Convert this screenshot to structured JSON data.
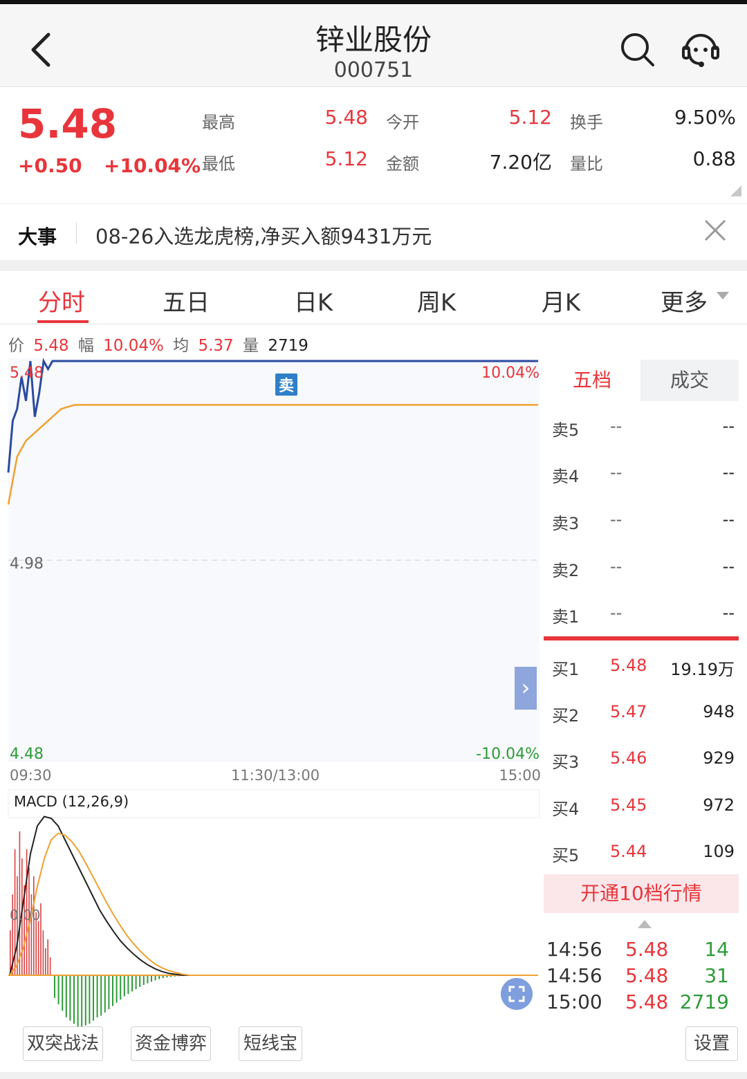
{
  "header": {
    "title": "锌业股份",
    "code": "000751"
  },
  "quote": {
    "price": "5.48",
    "change": "+0.50",
    "change_pct": "+10.04%",
    "stats": {
      "high_label": "最高",
      "high": "5.48",
      "open_label": "今开",
      "open": "5.12",
      "turnover_label": "换手",
      "turnover": "9.50%",
      "low_label": "最低",
      "low": "5.12",
      "amount_label": "金额",
      "amount": "7.20亿",
      "vol_ratio_label": "量比",
      "vol_ratio": "0.88"
    }
  },
  "news": {
    "tag": "大事",
    "text": "08-26入选龙虎榜,净买入额9431万元"
  },
  "tabs": [
    "分时",
    "五日",
    "日K",
    "周K",
    "月K",
    "更多"
  ],
  "active_tab": "分时",
  "info": {
    "price_label": "价",
    "price": "5.48",
    "amp_label": "幅",
    "amp": "10.04%",
    "avg_label": "均",
    "avg": "5.37",
    "vol_label": "量",
    "vol": "2719"
  },
  "chart_data": [
    {
      "type": "line",
      "y_axis_left": {
        "top": "5.48",
        "mid": "4.98",
        "bottom": "4.48"
      },
      "y_axis_right": {
        "top": "10.04%",
        "bottom": "-10.04%"
      },
      "x_labels": [
        "09:30",
        "11:30/13:00",
        "15:00"
      ],
      "ylim": [
        4.48,
        5.48
      ],
      "series": [
        {
          "name": "价",
          "color": "#2b4aa0",
          "points": [
            [
              0,
              5.2
            ],
            [
              2,
              5.33
            ],
            [
              4,
              5.36
            ],
            [
              6,
              5.44
            ],
            [
              8,
              5.38
            ],
            [
              10,
              5.48
            ],
            [
              12,
              5.34
            ],
            [
              14,
              5.4
            ],
            [
              16,
              5.48
            ],
            [
              18,
              5.46
            ],
            [
              20,
              5.48
            ],
            [
              240,
              5.48
            ]
          ]
        },
        {
          "name": "均",
          "color": "#f0a030",
          "points": [
            [
              0,
              5.12
            ],
            [
              4,
              5.24
            ],
            [
              8,
              5.28
            ],
            [
              12,
              5.3
            ],
            [
              18,
              5.33
            ],
            [
              24,
              5.36
            ],
            [
              30,
              5.37
            ],
            [
              240,
              5.37
            ]
          ]
        }
      ],
      "marker": {
        "label": "卖",
        "color": "#2f7fc8"
      }
    },
    {
      "type": "macd",
      "title": "MACD (12,26,9)",
      "zero_label": "0.00",
      "dif": [
        0,
        0.03,
        0.08,
        0.13,
        0.16,
        0.17,
        0.168,
        0.16,
        0.145,
        0.13,
        0.115,
        0.1,
        0.085,
        0.07,
        0.058,
        0.047,
        0.037,
        0.029,
        0.022,
        0.016,
        0.011,
        0.007,
        0.004,
        0.002,
        0.001,
        0,
        0
      ],
      "dea": [
        0,
        0.01,
        0.03,
        0.06,
        0.095,
        0.125,
        0.145,
        0.152,
        0.15,
        0.143,
        0.133,
        0.12,
        0.106,
        0.092,
        0.078,
        0.065,
        0.053,
        0.042,
        0.033,
        0.025,
        0.018,
        0.012,
        0.008,
        0.005,
        0.003,
        0.001,
        0
      ],
      "histogram_pos": [
        0.05,
        0.09,
        0.14,
        0.11,
        0.16,
        0.13,
        0.1,
        0.14,
        0.12,
        0.09,
        0.11,
        0.07,
        0.06,
        0.08,
        0.05,
        0.03,
        0.04,
        0.02
      ],
      "histogram_neg": [
        -0.07,
        -0.09,
        -0.11,
        -0.13,
        -0.14,
        -0.15,
        -0.16,
        -0.16,
        -0.155,
        -0.15,
        -0.14,
        -0.13,
        -0.125,
        -0.115,
        -0.105,
        -0.095,
        -0.085,
        -0.075,
        -0.065,
        -0.058,
        -0.05,
        -0.043,
        -0.036,
        -0.03,
        -0.025,
        -0.02,
        -0.016,
        -0.012,
        -0.009,
        -0.007,
        -0.005,
        -0.004,
        -0.003,
        -0.002,
        -0.001
      ]
    }
  ],
  "orderbook": {
    "tabs": [
      "五档",
      "成交"
    ],
    "sells": [
      {
        "label": "卖5",
        "price": "--",
        "vol": "--"
      },
      {
        "label": "卖4",
        "price": "--",
        "vol": "--"
      },
      {
        "label": "卖3",
        "price": "--",
        "vol": "--"
      },
      {
        "label": "卖2",
        "price": "--",
        "vol": "--"
      },
      {
        "label": "卖1",
        "price": "--",
        "vol": "--"
      }
    ],
    "buys": [
      {
        "label": "买1",
        "price": "5.48",
        "vol": "19.19万"
      },
      {
        "label": "买2",
        "price": "5.47",
        "vol": "948"
      },
      {
        "label": "买3",
        "price": "5.46",
        "vol": "929"
      },
      {
        "label": "买4",
        "price": "5.45",
        "vol": "972"
      },
      {
        "label": "买5",
        "price": "5.44",
        "vol": "109"
      }
    ],
    "open10_label": "开通10档行情"
  },
  "ticks": [
    {
      "time": "14:56",
      "price": "5.48",
      "vol": "14",
      "vol_color": "green"
    },
    {
      "time": "14:56",
      "price": "5.48",
      "vol": "31",
      "vol_color": "green"
    },
    {
      "time": "15:00",
      "price": "5.48",
      "vol": "2719",
      "vol_color": "green"
    }
  ],
  "bottom_buttons": [
    "双突战法",
    "资金博弈",
    "短线宝"
  ],
  "settings_label": "设置",
  "side_arrow": "›",
  "colors": {
    "red": "#e8353b",
    "green": "#2e9b38",
    "price_line": "#2b4aa0",
    "avg_line": "#f0a030"
  }
}
